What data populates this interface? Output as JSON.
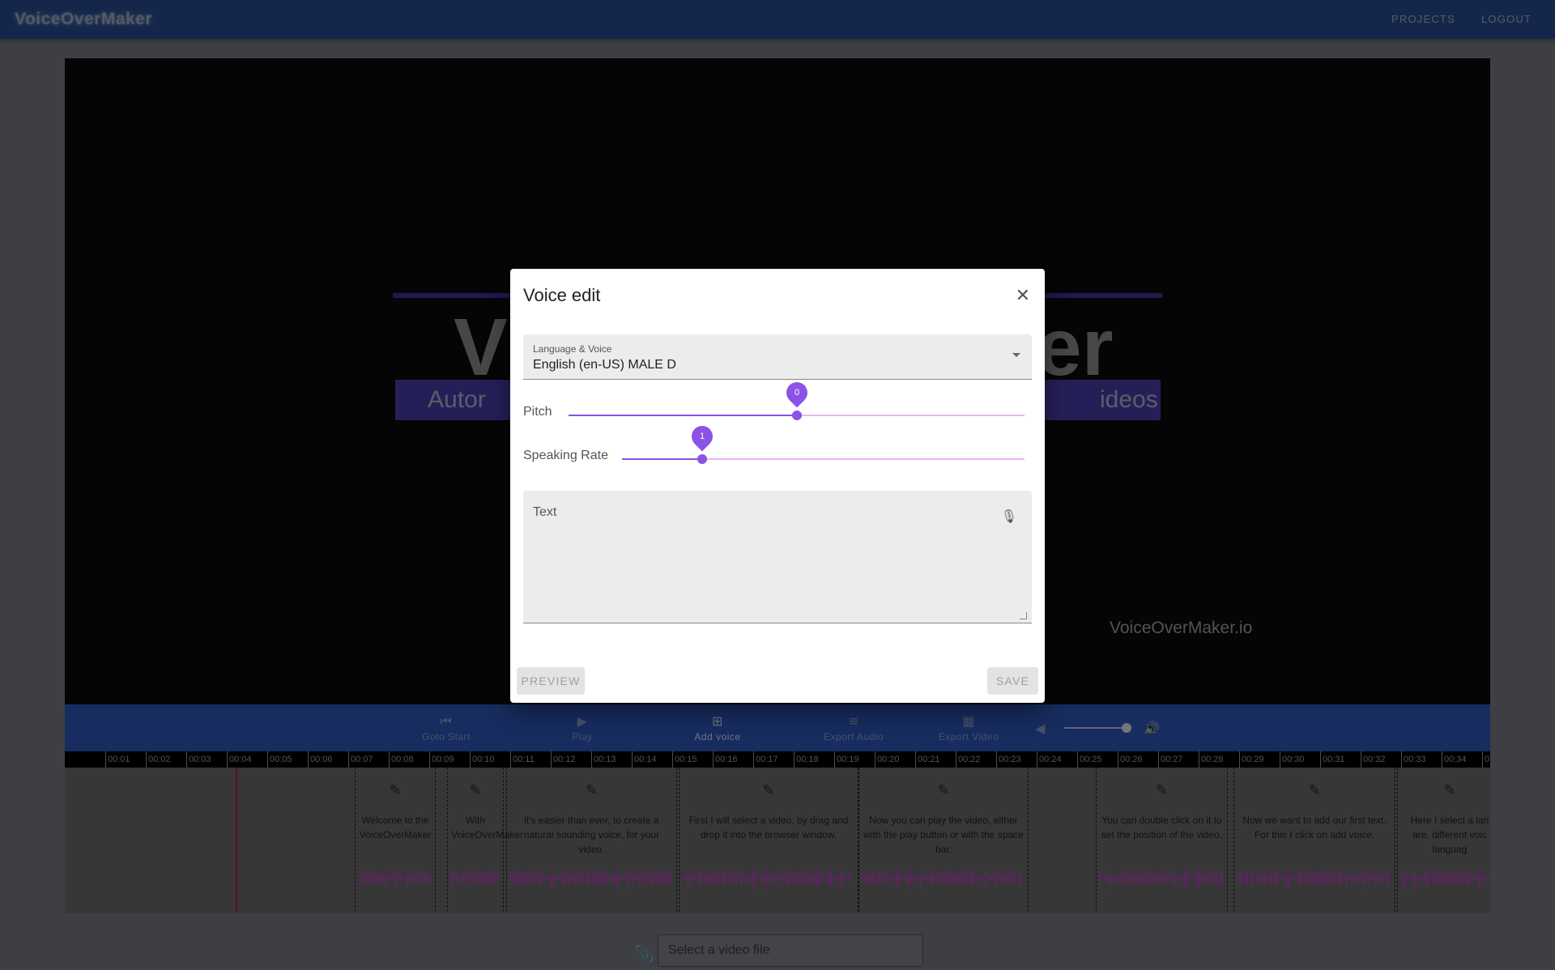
{
  "appbar": {
    "title": "VoiceOverMaker",
    "nav": [
      "PROJECTS",
      "LOGOUT"
    ]
  },
  "video_frame": {
    "big_left": "V",
    "big_right": "er",
    "band_left": "Autor",
    "band_right": "ideos",
    "watermark": "VoiceOverMaker.io"
  },
  "controls": [
    {
      "label": "Goto Start",
      "icon": "skip-previous-icon"
    },
    {
      "label": "Play",
      "icon": "play-icon"
    },
    {
      "label": "Add voice",
      "icon": "add-voice-icon"
    },
    {
      "label": "Export Audio",
      "icon": "audio-wave-icon"
    },
    {
      "label": "Export Video",
      "icon": "clapperboard-icon"
    }
  ],
  "volume": {
    "level": 1.0
  },
  "timeline": {
    "ticks": [
      "00:01",
      "00:02",
      "00:03",
      "00:04",
      "00:05",
      "00:06",
      "00:07",
      "00:08",
      "00:09",
      "00:10",
      "00:11",
      "00:12",
      "00:13",
      "00:14",
      "00:15",
      "00:16",
      "00:17",
      "00:18",
      "00:19",
      "00:20",
      "00:21",
      "00:22",
      "00:23",
      "00:24",
      "00:25",
      "00:26",
      "00:27",
      "00:28",
      "00:29",
      "00:30",
      "00:31",
      "00:32",
      "00:33",
      "00:34",
      "0"
    ],
    "segments": [
      "Welcome to the VoiceOverMaker",
      "With VoiceOverMaker",
      "it's easier than ever, to create a natural sounding voice, for your video.",
      "First I will select a video, by drag and drop it into the browser window.",
      "Now you can play the video, either with the play button or with the space bar.",
      "You can double click on it to set the position of the video.",
      "Now we want to add our first text. For this I click on add voice.",
      "Here I select a lan are, different voic languag"
    ]
  },
  "file_input": {
    "placeholder": "Select a video file"
  },
  "dialog": {
    "title": "Voice edit",
    "language_label": "Language & Voice",
    "language_value": "English (en-US) MALE D",
    "pitch_label": "Pitch",
    "pitch_value": "0",
    "rate_label": "Speaking Rate",
    "rate_value": "1",
    "text_label": "Text",
    "preview_label": "PREVIEW",
    "save_label": "SAVE"
  },
  "colors": {
    "appbar": "#284f97",
    "controls": "#2f58bf",
    "accent": "#8b52e6",
    "wave": "#b04fb8"
  }
}
